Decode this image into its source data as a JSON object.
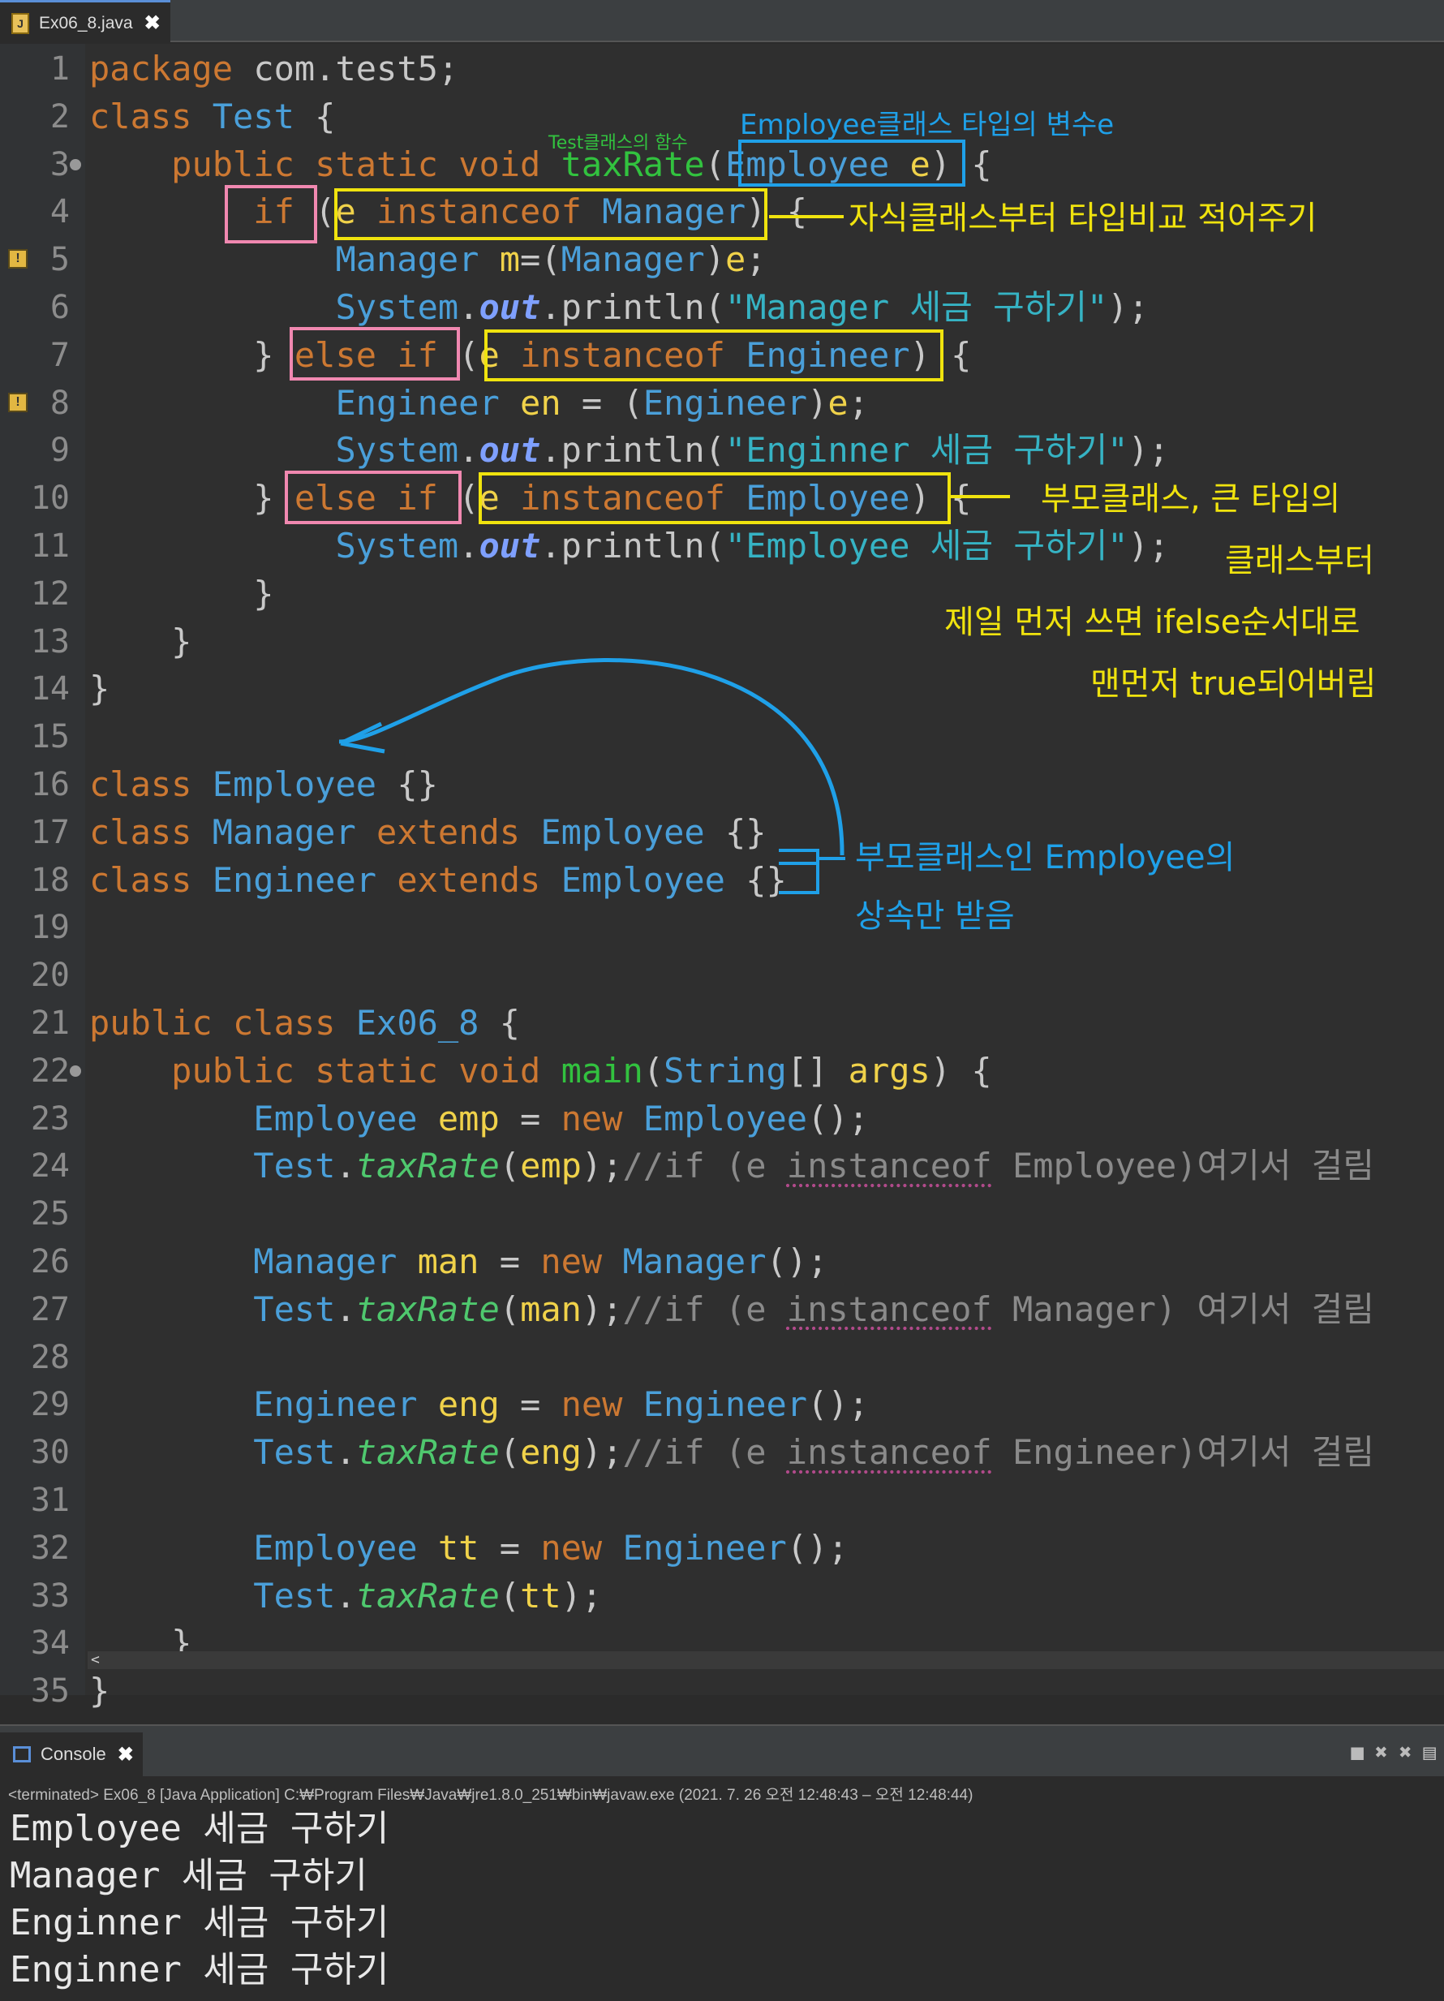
{
  "tab": {
    "label": "Ex06_8.java",
    "icon": "java-file-icon",
    "close": "✖"
  },
  "lines": [
    {
      "n": "1",
      "code": "package com.test5;"
    },
    {
      "n": "2",
      "code": "class Test {"
    },
    {
      "n": "3",
      "code": "    public static void taxRate(Employee e) {"
    },
    {
      "n": "4",
      "code": "        if (e instanceof Manager) {"
    },
    {
      "n": "5",
      "code": "            Manager m=(Manager)e;"
    },
    {
      "n": "6",
      "code": "            System.out.println(\"Manager 세금 구하기\");"
    },
    {
      "n": "7",
      "code": "        } else if (e instanceof Engineer) {"
    },
    {
      "n": "8",
      "code": "            Engineer en = (Engineer)e;"
    },
    {
      "n": "9",
      "code": "            System.out.println(\"Enginner 세금 구하기\");"
    },
    {
      "n": "10",
      "code": "        } else if (e instanceof Employee) {"
    },
    {
      "n": "11",
      "code": "            System.out.println(\"Employee 세금 구하기\");"
    },
    {
      "n": "12",
      "code": "        }"
    },
    {
      "n": "13",
      "code": "    }"
    },
    {
      "n": "14",
      "code": "}"
    },
    {
      "n": "15",
      "code": ""
    },
    {
      "n": "16",
      "code": "class Employee {}"
    },
    {
      "n": "17",
      "code": "class Manager extends Employee {}"
    },
    {
      "n": "18",
      "code": "class Engineer extends Employee {}"
    },
    {
      "n": "19",
      "code": ""
    },
    {
      "n": "20",
      "code": ""
    },
    {
      "n": "21",
      "code": "public class Ex06_8 {"
    },
    {
      "n": "22",
      "code": "    public static void main(String[] args) {"
    },
    {
      "n": "23",
      "code": "        Employee emp = new Employee();"
    },
    {
      "n": "24",
      "code": "        Test.taxRate(emp);//if (e instanceof Employee)여기서 걸림"
    },
    {
      "n": "25",
      "code": ""
    },
    {
      "n": "26",
      "code": "        Manager man = new Manager();"
    },
    {
      "n": "27",
      "code": "        Test.taxRate(man);//if (e instanceof Manager) 여기서 걸림"
    },
    {
      "n": "28",
      "code": ""
    },
    {
      "n": "29",
      "code": "        Engineer eng = new Engineer();"
    },
    {
      "n": "30",
      "code": "        Test.taxRate(eng);//if (e instanceof Engineer)여기서 걸림"
    },
    {
      "n": "31",
      "code": ""
    },
    {
      "n": "32",
      "code": "        Employee tt = new Engineer();"
    },
    {
      "n": "33",
      "code": "        Test.taxRate(tt);"
    },
    {
      "n": "34",
      "code": "    }"
    },
    {
      "n": "35",
      "code": "}"
    }
  ],
  "annotations": {
    "test_func": "Test클래스의 함수",
    "employee_var": "Employee클래스 타입의 변수e",
    "child_first": "자식클래스부터 타입비교 적어주기",
    "parent_note_1": "부모클래스, 큰 타입의",
    "parent_note_2": "클래스부터",
    "parent_note_3": "제일 먼저 쓰면 ifelse순서대로",
    "parent_note_4": "맨먼저 true되어버림",
    "inherit_note_1": "부모클래스인 Employee의",
    "inherit_note_2": "상속만 받음"
  },
  "scroll_left": "<",
  "console": {
    "tab_label": "Console",
    "tab_icon": "console-icon",
    "tab_close": "✖",
    "status": "<terminated> Ex06_8 [Java Application] C:₩Program Files₩Java₩jre1.8.0_251₩bin₩javaw.exe  (2021. 7. 26 오전 12:48:43 – 오전 12:48:44)",
    "output": [
      "Employee 세금 구하기",
      "Manager 세금 구하기",
      "Enginner 세금 구하기",
      "Enginner 세금 구하기"
    ]
  },
  "colors": {
    "keyword": "#cc7832",
    "type": "#4a9fd9",
    "variable": "#f0d24a",
    "method": "#32c23f",
    "string": "#36b3c4",
    "annotation_yellow": "#f0e30e",
    "annotation_blue": "#1fa0e8",
    "annotation_green": "#32c23f",
    "box_pink": "#f088b0"
  }
}
